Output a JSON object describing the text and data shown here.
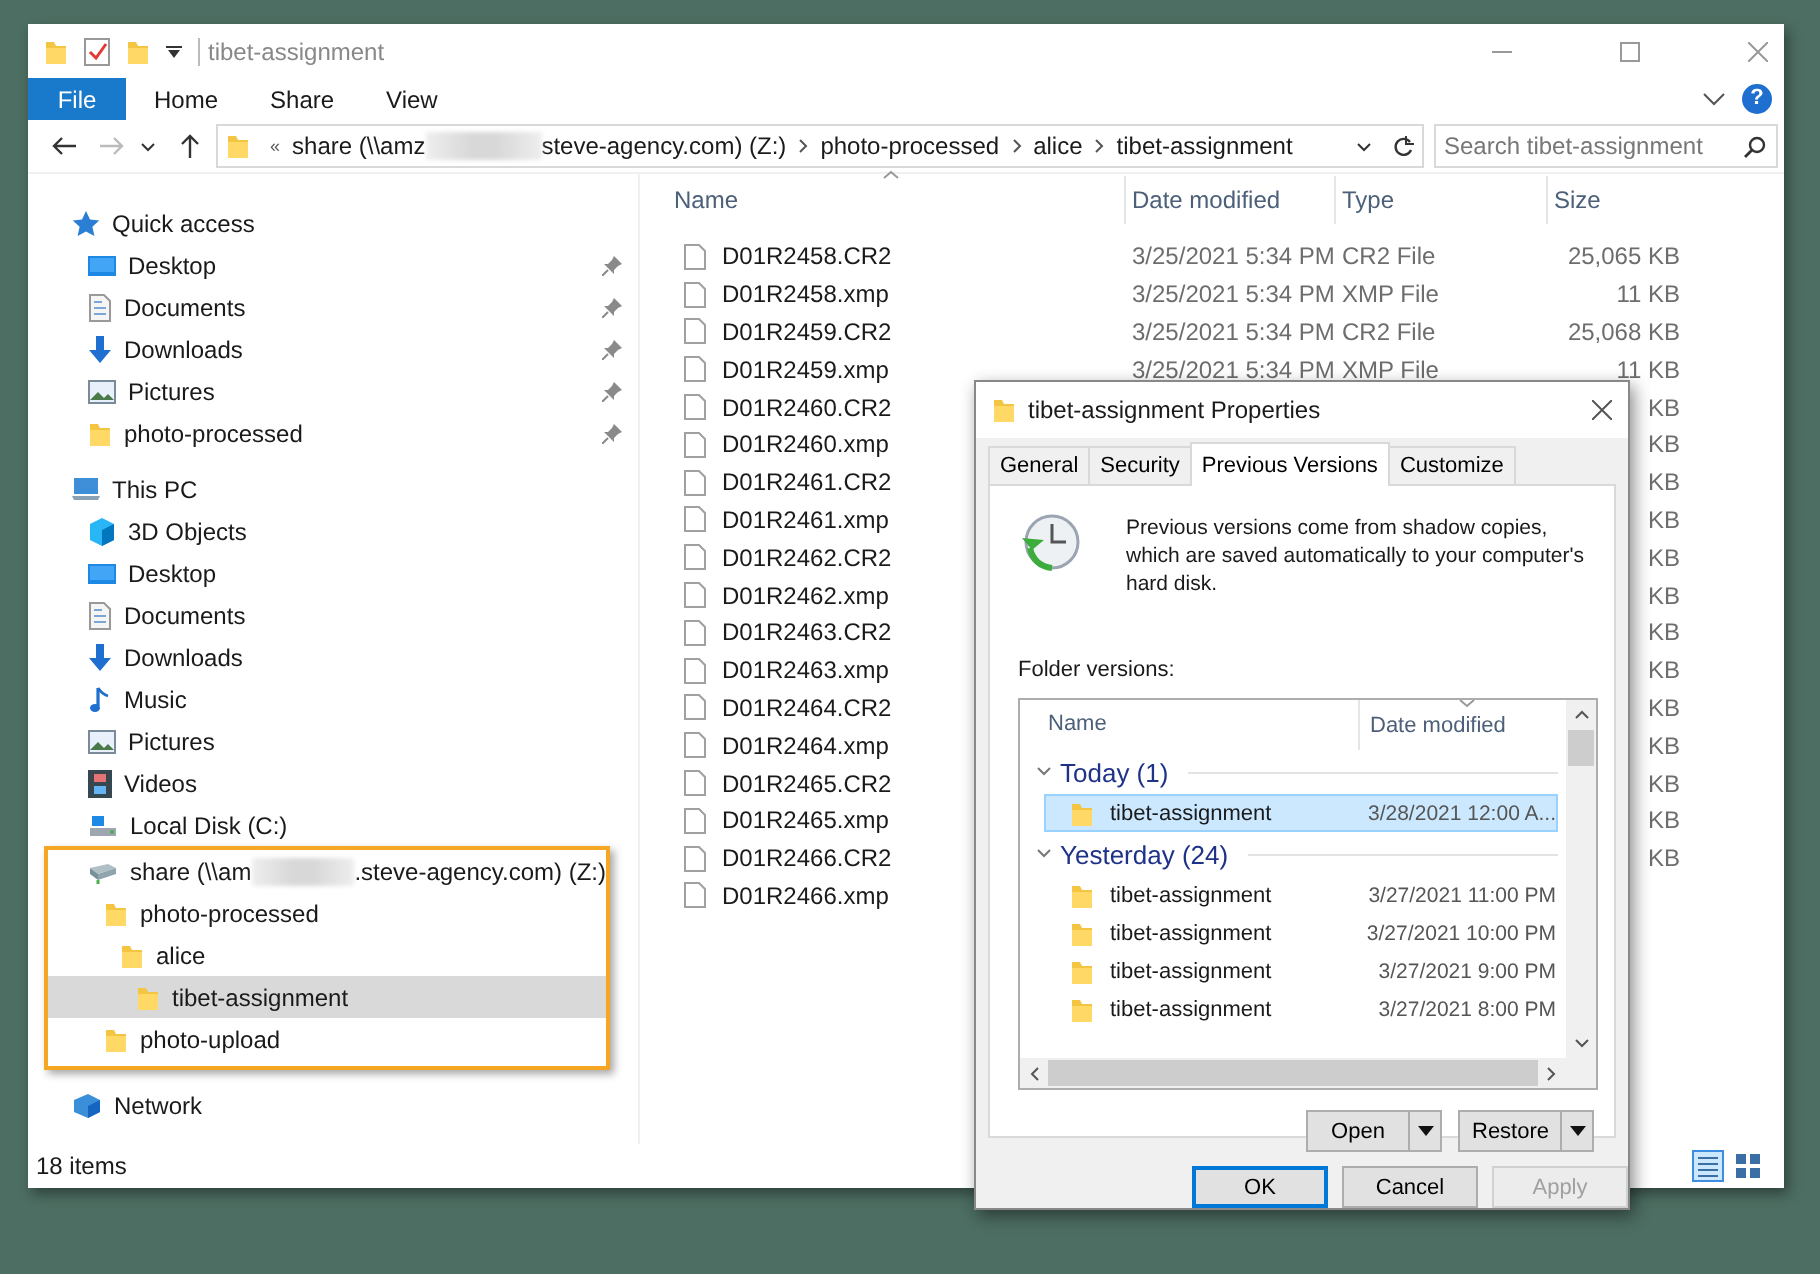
{
  "explorer": {
    "title": "tibet-assignment",
    "ribbon": {
      "file_tab": "File",
      "tabs": [
        "Home",
        "Share",
        "View"
      ],
      "help": "?"
    },
    "nav_buttons": [
      {
        "kind": "back",
        "disabled": false
      },
      {
        "kind": "forward",
        "disabled": true
      },
      {
        "kind": "recent",
        "disabled": false
      },
      {
        "kind": "up",
        "disabled": false
      }
    ],
    "address": {
      "overflow": "«",
      "segments": [
        {
          "texts": [
            "share (\\\\amz",
            "steve-agency.com) (Z:)"
          ]
        },
        {
          "texts": [
            "photo-processed"
          ]
        },
        {
          "texts": [
            "alice"
          ]
        },
        {
          "texts": [
            "tibet-assignment"
          ]
        }
      ]
    },
    "search": {
      "placeholder": "Search tibet-assignment"
    },
    "nav": [
      {
        "kind": "star",
        "label": "Quick access",
        "selected": false,
        "children": [
          {
            "kind": "desktop",
            "label": "Desktop",
            "pinned": true,
            "selected": false
          },
          {
            "kind": "documents",
            "label": "Documents",
            "pinned": true,
            "selected": false
          },
          {
            "kind": "downloads",
            "label": "Downloads",
            "pinned": true,
            "selected": false
          },
          {
            "kind": "pictures",
            "label": "Pictures",
            "pinned": true,
            "selected": false
          },
          {
            "kind": "folder",
            "label": "photo-processed",
            "pinned": true,
            "selected": false
          }
        ]
      },
      {
        "kind": "pc",
        "label": "This PC",
        "selected": false,
        "children": [
          {
            "kind": "cube",
            "label": "3D Objects",
            "selected": false
          },
          {
            "kind": "desktop",
            "label": "Desktop",
            "selected": false
          },
          {
            "kind": "documents",
            "label": "Documents",
            "selected": false
          },
          {
            "kind": "downloads",
            "label": "Downloads",
            "selected": false
          },
          {
            "kind": "music",
            "label": "Music",
            "selected": false
          },
          {
            "kind": "pictures",
            "label": "Pictures",
            "selected": false
          },
          {
            "kind": "videos",
            "label": "Videos",
            "selected": false
          },
          {
            "kind": "disk",
            "label": "Local Disk (C:)",
            "selected": false
          },
          {
            "kind": "network-drive",
            "label_parts": [
              "share (\\\\am",
              ".steve-agency.com) (Z:)"
            ],
            "highlighted": true,
            "selected": false,
            "children": [
              {
                "kind": "folder",
                "label": "photo-processed",
                "selected": false,
                "children": [
                  {
                    "kind": "folder",
                    "label": "alice",
                    "selected": false,
                    "children": [
                      {
                        "kind": "folder",
                        "label": "tibet-assignment",
                        "selected": true
                      }
                    ]
                  }
                ]
              },
              {
                "kind": "folder",
                "label": "photo-upload",
                "selected": false
              }
            ]
          }
        ]
      },
      {
        "kind": "network",
        "label": "Network",
        "selected": false
      }
    ],
    "columns": [
      "Name",
      "Date modified",
      "Type",
      "Size"
    ],
    "files": [
      {
        "name": "D01R2458.CR2",
        "date": "3/25/2021 5:34 PM",
        "type": "CR2 File",
        "size": "25,065 KB"
      },
      {
        "name": "D01R2458.xmp",
        "date": "3/25/2021 5:34 PM",
        "type": "XMP File",
        "size": "11 KB"
      },
      {
        "name": "D01R2459.CR2",
        "date": "3/25/2021 5:34 PM",
        "type": "CR2 File",
        "size": "25,068 KB"
      },
      {
        "name": "D01R2459.xmp",
        "date": "3/25/2021 5:34 PM",
        "type": "XMP File",
        "size": "11 KB"
      },
      {
        "name": "D01R2460.CR2",
        "size": "KB"
      },
      {
        "name": "D01R2460.xmp",
        "size": "KB"
      },
      {
        "name": "D01R2461.CR2",
        "size": "KB"
      },
      {
        "name": "D01R2461.xmp",
        "size": "KB"
      },
      {
        "name": "D01R2462.CR2",
        "size": "KB"
      },
      {
        "name": "D01R2462.xmp",
        "size": "KB"
      },
      {
        "name": "D01R2463.CR2",
        "size": "KB"
      },
      {
        "name": "D01R2463.xmp",
        "size": "KB"
      },
      {
        "name": "D01R2464.CR2",
        "size": "KB"
      },
      {
        "name": "D01R2464.xmp",
        "size": "KB"
      },
      {
        "name": "D01R2465.CR2",
        "size": "KB"
      },
      {
        "name": "D01R2465.xmp",
        "size": "KB"
      },
      {
        "name": "D01R2466.CR2",
        "size": "KB"
      },
      {
        "name": "D01R2466.xmp"
      }
    ],
    "status": "18 items",
    "view_buttons": [
      {
        "kind": "details",
        "selected": true
      },
      {
        "kind": "large-icons",
        "selected": false
      }
    ]
  },
  "dialog": {
    "title": "tibet-assignment Properties",
    "tabs": [
      {
        "label": "General",
        "selected": false
      },
      {
        "label": "Security",
        "selected": false
      },
      {
        "label": "Previous Versions",
        "selected": true
      },
      {
        "label": "Customize",
        "selected": false
      }
    ],
    "description": "Previous versions come from shadow copies, which are saved automatically to your computer's hard disk.",
    "section_label": "Folder versions:",
    "columns": [
      "Name",
      "Date modified"
    ],
    "groups": [
      {
        "label": "Today (1)",
        "expanded": true,
        "items": [
          {
            "name": "tibet-assignment",
            "date": "3/28/2021 12:00 A...",
            "selected": true
          }
        ]
      },
      {
        "label": "Yesterday (24)",
        "expanded": true,
        "items": [
          {
            "name": "tibet-assignment",
            "date": "3/27/2021 11:00 PM",
            "selected": false
          },
          {
            "name": "tibet-assignment",
            "date": "3/27/2021 10:00 PM",
            "selected": false
          },
          {
            "name": "tibet-assignment",
            "date": "3/27/2021 9:00 PM",
            "selected": false
          },
          {
            "name": "tibet-assignment",
            "date": "3/27/2021 8:00 PM",
            "selected": false
          }
        ]
      }
    ],
    "action_buttons": [
      "Open",
      "Restore"
    ],
    "footer_buttons": [
      {
        "label": "OK",
        "default": true,
        "disabled": false
      },
      {
        "label": "Cancel",
        "default": false,
        "disabled": false
      },
      {
        "label": "Apply",
        "default": false,
        "disabled": true
      }
    ]
  }
}
